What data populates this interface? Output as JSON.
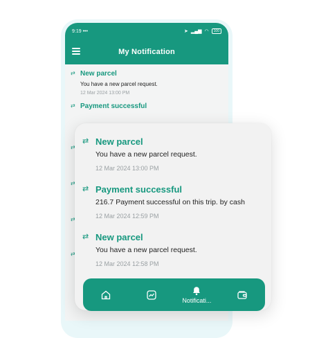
{
  "status_bar": {
    "time": "9:19",
    "dots": "•••",
    "battery": "100"
  },
  "header": {
    "title": "My Notification"
  },
  "background_list": [
    {
      "title": "New parcel",
      "message": "You have a new parcel request.",
      "date": "12 Mar 2024  13:00 PM"
    },
    {
      "title": "Payment successful",
      "message": "",
      "date": ""
    },
    {
      "title": "",
      "message": "",
      "date": ""
    },
    {
      "title": "",
      "message": "",
      "date": ""
    },
    {
      "title": "",
      "message": "",
      "date": ""
    },
    {
      "title": "",
      "message": "",
      "date": ""
    }
  ],
  "card_list": [
    {
      "title": "New parcel",
      "message": "You have a new parcel request.",
      "date": "12 Mar 2024  13:00 PM"
    },
    {
      "title": "Payment successful",
      "message": "216.7 Payment successful on this trip. by cash",
      "date": "12 Mar 2024  12:59 PM"
    },
    {
      "title": "New parcel",
      "message": "You have a new parcel request.",
      "date": "12 Mar 2024  12:58 PM"
    }
  ],
  "tabs": [
    {
      "name": "home",
      "label": "",
      "icon": "home-icon"
    },
    {
      "name": "activity",
      "label": "",
      "icon": "chart-icon"
    },
    {
      "name": "notifications",
      "label": "Notificati...",
      "icon": "bell-icon"
    },
    {
      "name": "wallet",
      "label": "",
      "icon": "wallet-icon"
    }
  ],
  "colors": {
    "primary": "#17987f",
    "background": "#f3f4f4",
    "date": "#9aa0a3"
  }
}
